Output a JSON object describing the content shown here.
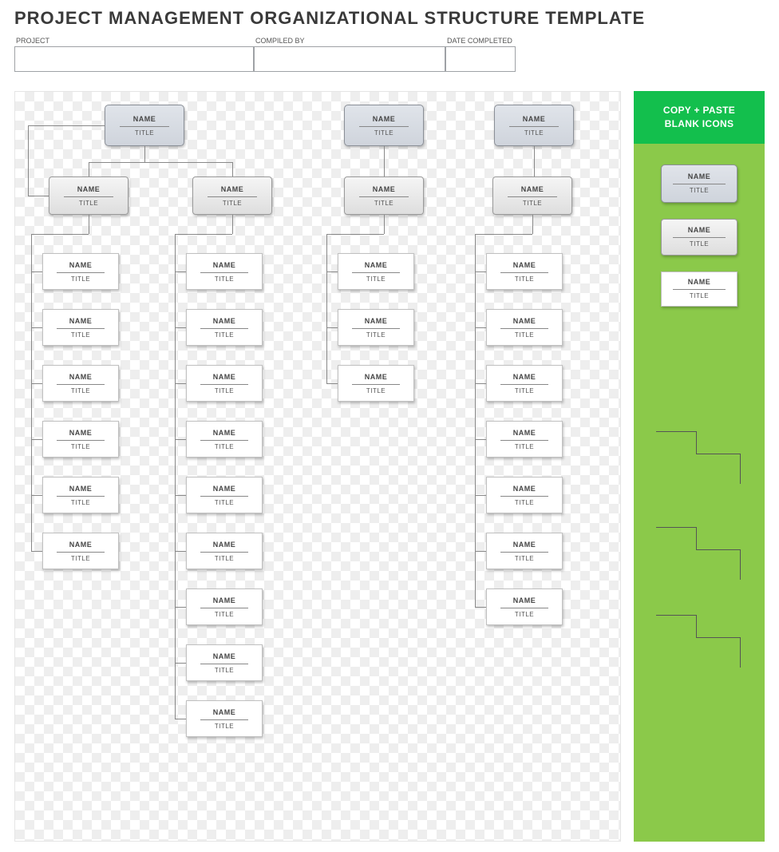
{
  "page_title": "PROJECT MANAGEMENT ORGANIZATIONAL STRUCTURE TEMPLATE",
  "meta": {
    "project_label": "PROJECT",
    "compiled_by_label": "COMPILED BY",
    "date_completed_label": "DATE COMPLETED",
    "project_value": "",
    "compiled_by_value": "",
    "date_completed_value": ""
  },
  "sidebar": {
    "header_line1": "COPY + PASTE",
    "header_line2": "BLANK ICONS",
    "icons": [
      {
        "style": "top",
        "name": "NAME",
        "title": "TITLE"
      },
      {
        "style": "mid",
        "name": "NAME",
        "title": "TITLE"
      },
      {
        "style": "leaf",
        "name": "NAME",
        "title": "TITLE"
      }
    ]
  },
  "org": {
    "default_name": "NAME",
    "default_title": "TITLE",
    "roots": [
      {
        "name": "NAME",
        "title": "TITLE",
        "children": [
          {
            "name": "NAME",
            "title": "TITLE",
            "children": [
              {
                "name": "NAME",
                "title": "TITLE"
              },
              {
                "name": "NAME",
                "title": "TITLE"
              },
              {
                "name": "NAME",
                "title": "TITLE"
              },
              {
                "name": "NAME",
                "title": "TITLE"
              },
              {
                "name": "NAME",
                "title": "TITLE"
              },
              {
                "name": "NAME",
                "title": "TITLE"
              }
            ]
          },
          {
            "name": "NAME",
            "title": "TITLE",
            "children": [
              {
                "name": "NAME",
                "title": "TITLE"
              },
              {
                "name": "NAME",
                "title": "TITLE"
              },
              {
                "name": "NAME",
                "title": "TITLE"
              },
              {
                "name": "NAME",
                "title": "TITLE"
              },
              {
                "name": "NAME",
                "title": "TITLE"
              },
              {
                "name": "NAME",
                "title": "TITLE"
              },
              {
                "name": "NAME",
                "title": "TITLE"
              },
              {
                "name": "NAME",
                "title": "TITLE"
              },
              {
                "name": "NAME",
                "title": "TITLE"
              }
            ]
          }
        ]
      },
      {
        "name": "NAME",
        "title": "TITLE",
        "children": [
          {
            "name": "NAME",
            "title": "TITLE",
            "children": [
              {
                "name": "NAME",
                "title": "TITLE"
              },
              {
                "name": "NAME",
                "title": "TITLE"
              },
              {
                "name": "NAME",
                "title": "TITLE"
              }
            ]
          }
        ]
      },
      {
        "name": "NAME",
        "title": "TITLE",
        "children": [
          {
            "name": "NAME",
            "title": "TITLE",
            "children": [
              {
                "name": "NAME",
                "title": "TITLE"
              },
              {
                "name": "NAME",
                "title": "TITLE"
              },
              {
                "name": "NAME",
                "title": "TITLE"
              },
              {
                "name": "NAME",
                "title": "TITLE"
              },
              {
                "name": "NAME",
                "title": "TITLE"
              },
              {
                "name": "NAME",
                "title": "TITLE"
              },
              {
                "name": "NAME",
                "title": "TITLE"
              }
            ]
          }
        ]
      }
    ]
  }
}
